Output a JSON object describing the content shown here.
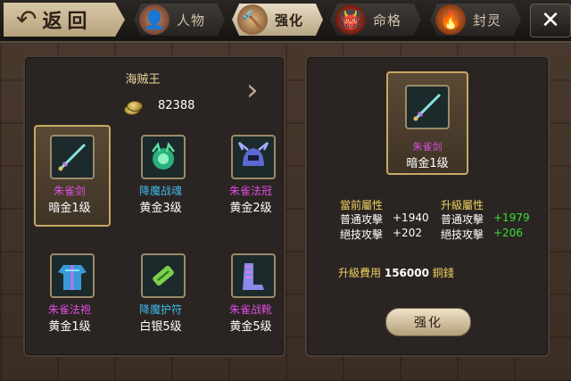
{
  "header": {
    "back_label": "返回",
    "tabs": [
      {
        "label": "人物",
        "icon": "character-portrait-icon",
        "active": false
      },
      {
        "label": "强化",
        "icon": "hammer-icon",
        "active": true
      },
      {
        "label": "命格",
        "icon": "demon-face-icon",
        "active": false
      },
      {
        "label": "封灵",
        "icon": "fire-sword-icon",
        "active": false
      }
    ],
    "close_glyph": "✕"
  },
  "player": {
    "name": "海贼王",
    "copper": "82388"
  },
  "items": [
    {
      "name": "朱雀剑",
      "grade": "暗金1级",
      "color": "#e04ce0",
      "icon": "sword-icon",
      "selected": true
    },
    {
      "name": "降魔战魂",
      "grade": "黄金3级",
      "color": "#3fb8e8",
      "icon": "spirit-orb-icon",
      "selected": false
    },
    {
      "name": "朱雀法冠",
      "grade": "黄金2级",
      "color": "#e04ce0",
      "icon": "helmet-icon",
      "selected": false
    },
    {
      "name": "朱雀法袍",
      "grade": "黄金1级",
      "color": "#e04ce0",
      "icon": "robe-icon",
      "selected": false
    },
    {
      "name": "降魔护符",
      "grade": "白银5级",
      "color": "#3fb8e8",
      "icon": "talisman-scroll-icon",
      "selected": false
    },
    {
      "name": "朱雀战靴",
      "grade": "黄金5级",
      "color": "#e04ce0",
      "icon": "boots-icon",
      "selected": false
    }
  ],
  "detail": {
    "name": "朱雀剑",
    "grade": "暗金1级",
    "current_header": "當前屬性",
    "upgrade_header": "升級屬性",
    "current": [
      {
        "label": "普通攻擊",
        "value": "+1940"
      },
      {
        "label": "絕技攻擊",
        "value": "+202"
      }
    ],
    "upgrade": [
      {
        "label": "普通攻擊",
        "value": "+1979"
      },
      {
        "label": "絕技攻擊",
        "value": "+206"
      }
    ],
    "cost_label": "升級費用",
    "cost_value": "156000",
    "cost_unit": "銅錢",
    "button_label": "强化"
  }
}
